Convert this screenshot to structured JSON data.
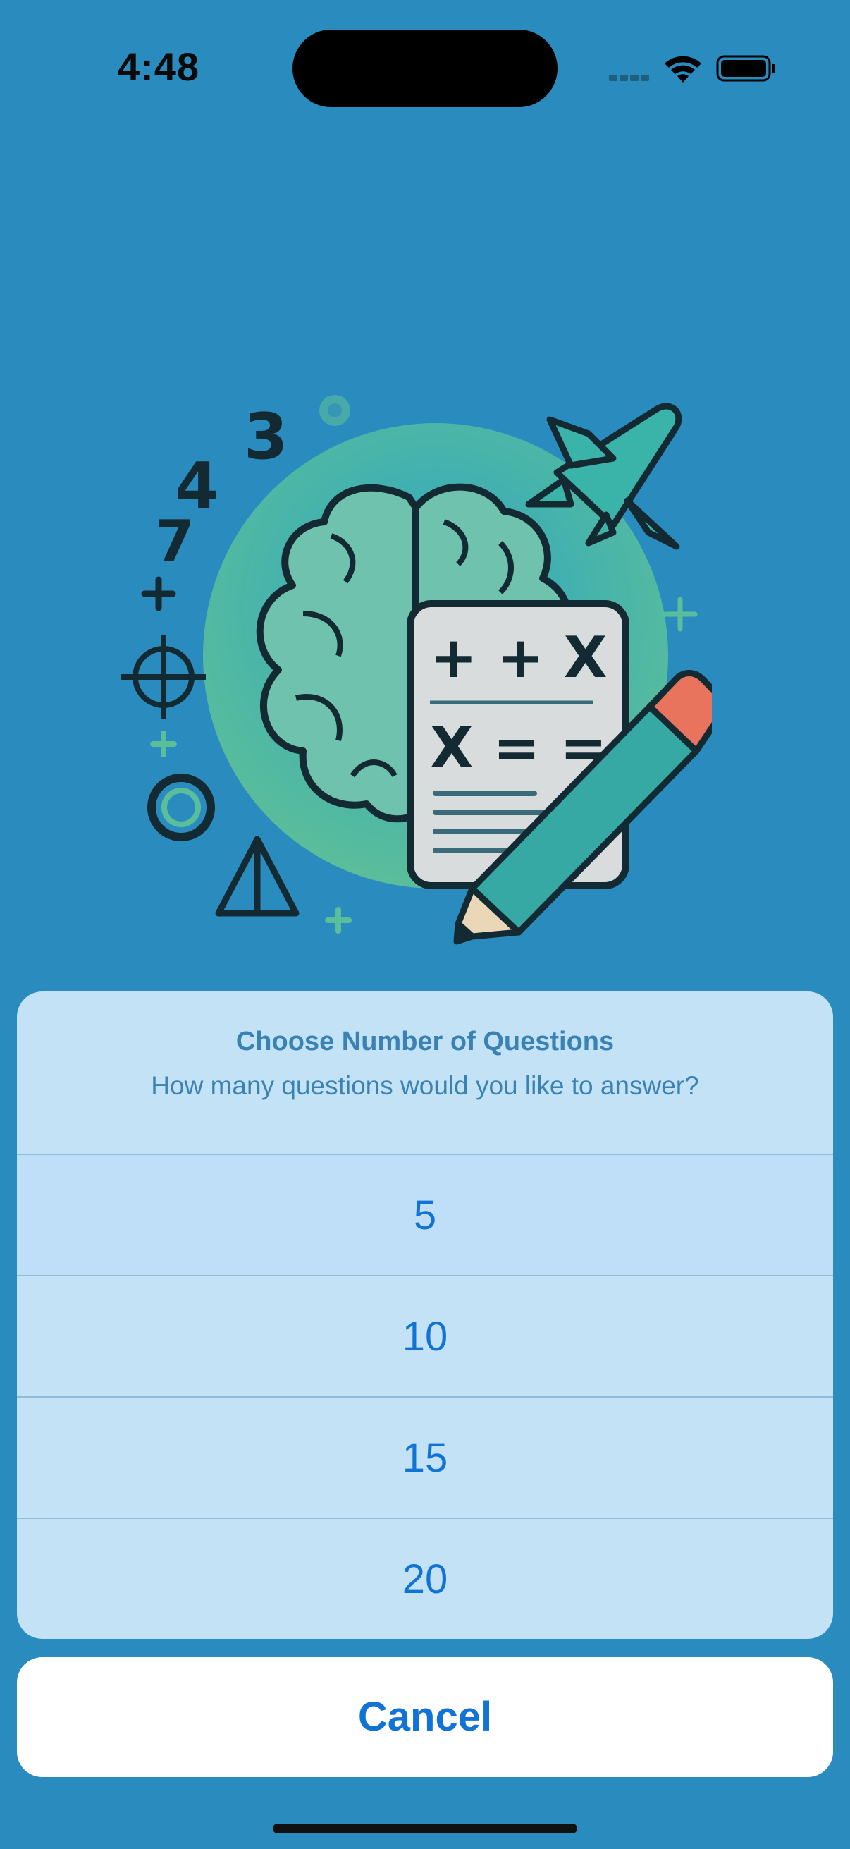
{
  "status_bar": {
    "time": "4:48",
    "icons": [
      "signal-icon",
      "wifi-icon",
      "battery-icon"
    ]
  },
  "illustration": {
    "icon": "brain-math-illustration",
    "glyphs": [
      "3",
      "4",
      "7",
      "+ + X",
      "X = ="
    ]
  },
  "action_sheet": {
    "title": "Choose Number of Questions",
    "message": "How many questions would you like to answer?",
    "options": [
      {
        "label": "5"
      },
      {
        "label": "10"
      },
      {
        "label": "15"
      },
      {
        "label": "20"
      }
    ],
    "cancel_label": "Cancel"
  },
  "colors": {
    "background": "#2A8BBE",
    "sheet": "#C3E2F5",
    "accent": "#1273D6",
    "sheet_text": "#3A82B3"
  }
}
